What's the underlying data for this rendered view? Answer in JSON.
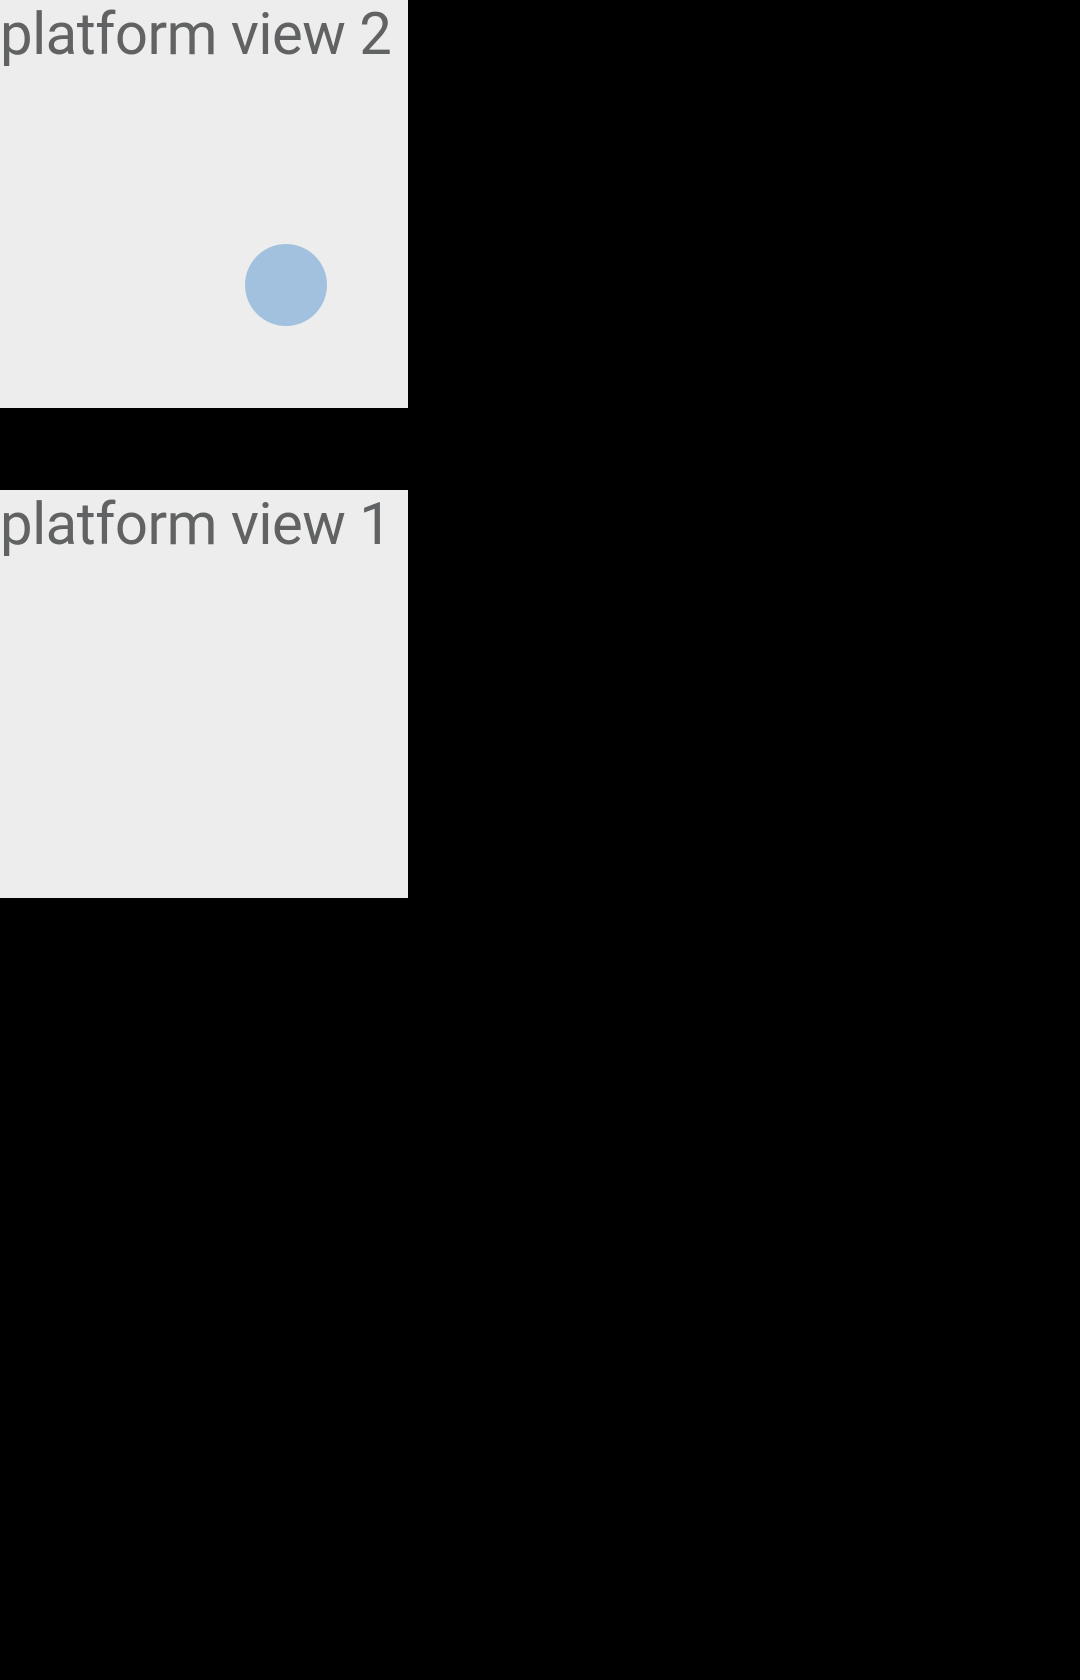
{
  "views": {
    "view2": {
      "label": "platform view 2"
    },
    "view1": {
      "label": "platform view 1"
    }
  },
  "colors": {
    "background": "#000000",
    "viewBackground": "#ededed",
    "labelText": "#616263",
    "circleIndicator": "#a1c1df"
  }
}
